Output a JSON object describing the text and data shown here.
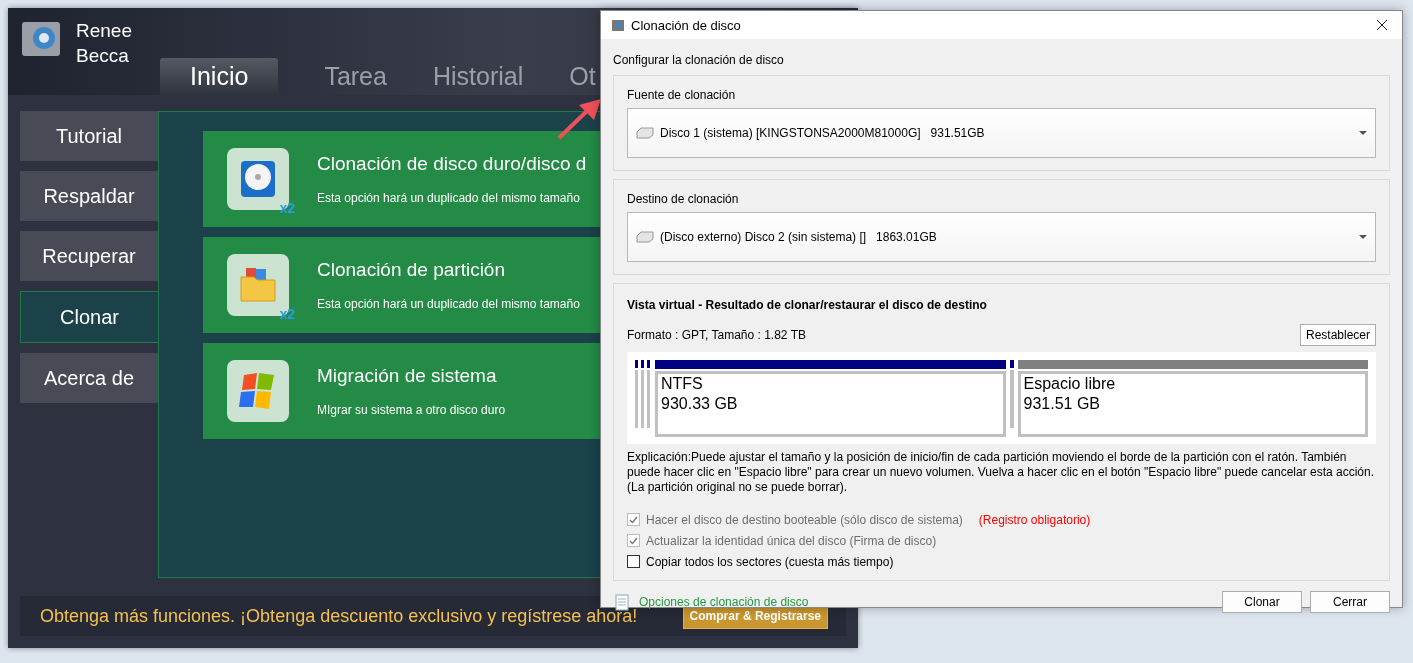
{
  "main_window": {
    "app_name": "Renee Becca",
    "tabs": [
      {
        "label": "Inicio",
        "selected": true
      },
      {
        "label": "Tarea",
        "selected": false
      },
      {
        "label": "Historial",
        "selected": false
      },
      {
        "label": "Ot",
        "selected": false
      }
    ],
    "sidebar": {
      "items": [
        {
          "label": "Tutorial",
          "selected": false
        },
        {
          "label": "Respaldar",
          "selected": false
        },
        {
          "label": "Recuperar",
          "selected": false
        },
        {
          "label": "Clonar",
          "selected": true
        },
        {
          "label": "Acerca de",
          "selected": false
        }
      ]
    },
    "cards": [
      {
        "kind": "disk",
        "title": "Clonación de disco duro/disco d",
        "description": "Esta opción hará un duplicado del mismo tamaño",
        "badge": "x2"
      },
      {
        "kind": "partition",
        "title": "Clonación de partición",
        "description": "Esta opción hará un duplicado del mismo tamaño",
        "badge": "x2"
      },
      {
        "kind": "system",
        "title": "Migración de sistema",
        "description": "MIgrar su sistema a otro disco duro"
      }
    ],
    "promo": {
      "text": "Obtenga más funciones. ¡Obtenga descuento exclusivo y regístrese ahora!",
      "button": "Comprar & Registrarse"
    }
  },
  "dialog": {
    "title": "Clonación de disco",
    "heading": "Configurar la clonación de disco",
    "source": {
      "label": "Fuente de clonación",
      "value": "Disco 1 (sistema) [KINGSTONSA2000M81000G]   931.51GB"
    },
    "destination": {
      "label": "Destino de clonación",
      "value": "(Disco externo) Disco 2 (sin sistema) []   1863.01GB"
    },
    "virtual_view": {
      "title": "Vista virtual - Resultado de clonar/restaurar el disco de destino",
      "format": "Formato : GPT,  Tamaño : 1.82 TB",
      "reset_button": "Restablecer",
      "partitions": [
        {
          "kind": "used",
          "name": "NTFS",
          "size": "930.33 GB"
        },
        {
          "kind": "free",
          "name": "Espacio libre",
          "size": "931.51 GB"
        }
      ]
    },
    "explanation": "Explicación:Puede ajustar el tamaño y la posición de inicio/fin de cada partición moviendo el borde de la partición con el ratón. También puede hacer clic en \"Espacio libre\" para crear un nuevo volumen. Vuelva a hacer clic en el botón \"Espacio libre\" puede cancelar esta acción. (La partición original no se puede borrar).",
    "options": [
      {
        "label": "Hacer el disco de destino booteable (sólo disco de sistema)",
        "checked": true,
        "disabled": true,
        "note": "(Registro obligatorio)"
      },
      {
        "label": "Actualizar la identidad única del disco (Firma de disco)",
        "checked": true,
        "disabled": true
      },
      {
        "label": "Copiar todos los sectores (cuesta más tiempo)",
        "checked": false,
        "disabled": false
      }
    ],
    "options_link": "Opciones de clonación de disco",
    "buttons": [
      "Clonar",
      "Cerrar"
    ]
  }
}
